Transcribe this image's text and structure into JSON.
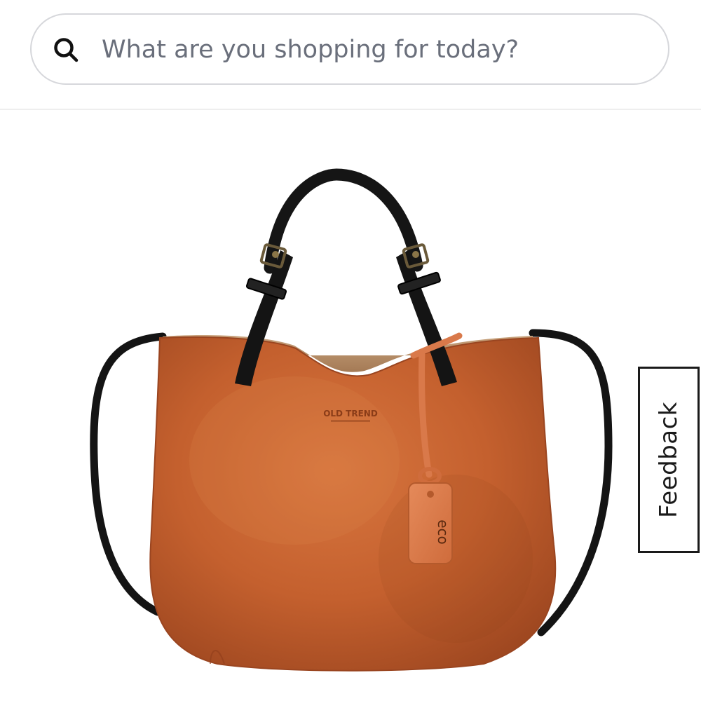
{
  "search": {
    "placeholder": "What are you shopping for today?",
    "icon": "search-icon"
  },
  "product": {
    "image_alt": "Cognac leather tote bag with black handles and crossbody strap",
    "brand_stamp": "OLD TREND",
    "tag_text": "eco",
    "colors": {
      "leather": "#c4602e",
      "straps": "#151515"
    }
  },
  "feedback": {
    "label": "Feedback"
  }
}
